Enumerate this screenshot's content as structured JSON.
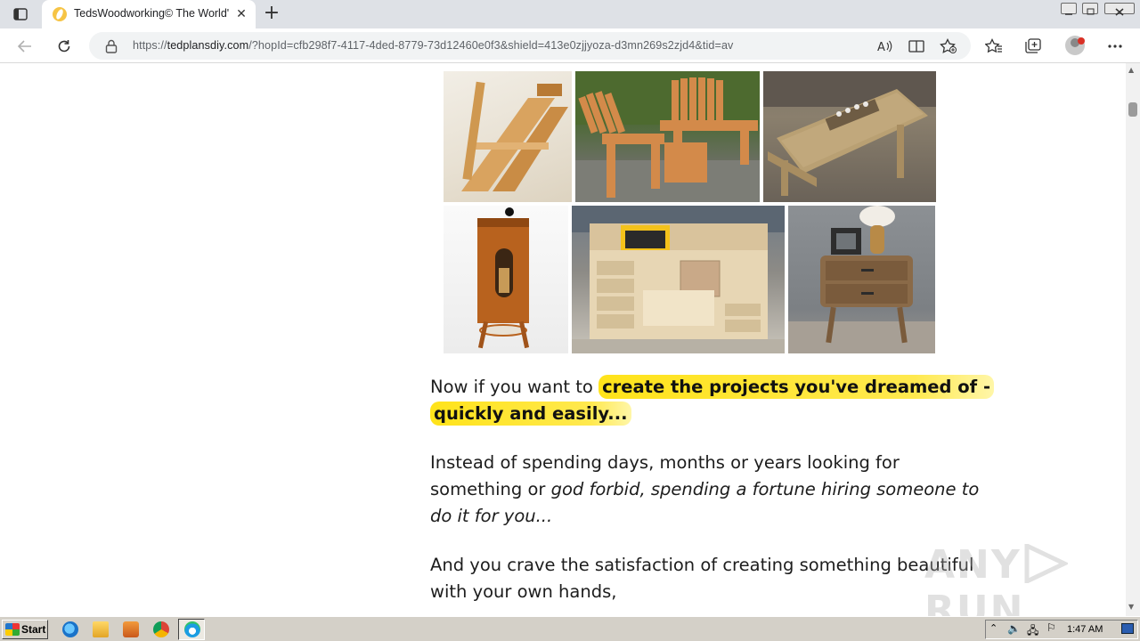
{
  "browser": {
    "tab_title": "TedsWoodworking© The World's",
    "tab_close_glyph": "✕",
    "new_tab_glyph": "+",
    "url_prefix": "https://",
    "url_host": "tedplansdiy.com",
    "url_rest": "/?hopId=cfb298f7-4117-4ded-8779-73d12460e0f3&shield=413e0zjjyoza-d3mn269s2zjd4&tid=av",
    "icons": [
      "tab-actions-icon",
      "back-icon",
      "refresh-icon",
      "lock-icon",
      "read-aloud-icon",
      "immersive-reader-icon",
      "add-favorite-icon",
      "favorites-icon",
      "collections-icon",
      "profile-avatar",
      "more-menu-icon",
      "minimize-icon",
      "restore-icon",
      "close-window-icon"
    ]
  },
  "page": {
    "images": [
      {
        "name": "chair"
      },
      {
        "name": "adirondack-chairs"
      },
      {
        "name": "picnic-table"
      },
      {
        "name": "dispenser"
      },
      {
        "name": "table-saw-workbench"
      },
      {
        "name": "nightstand"
      }
    ],
    "p1_plain": "Now if you want to ",
    "p1_highlight": "create the projects you've dreamed of - quickly and easily...",
    "p2_plain": "Instead of spending days, months or years looking for something or ",
    "p2_italic": "god forbid, spending a fortune hiring someone to do it for you...",
    "p3": "And you crave the satisfaction of creating something beautiful with your own hands,",
    "watermark_text": "ANY",
    "watermark_text2": "RUN"
  },
  "taskbar": {
    "start_label": "Start",
    "clock": "1:47 AM",
    "apps": [
      "internet-explorer-icon",
      "folder-icon",
      "media-player-icon",
      "chrome-icon",
      "edge-icon"
    ]
  },
  "colors": {
    "highlight": "#ffe31a",
    "tab_bar": "#dee1e6",
    "taskbar": "#d4d0c8"
  }
}
